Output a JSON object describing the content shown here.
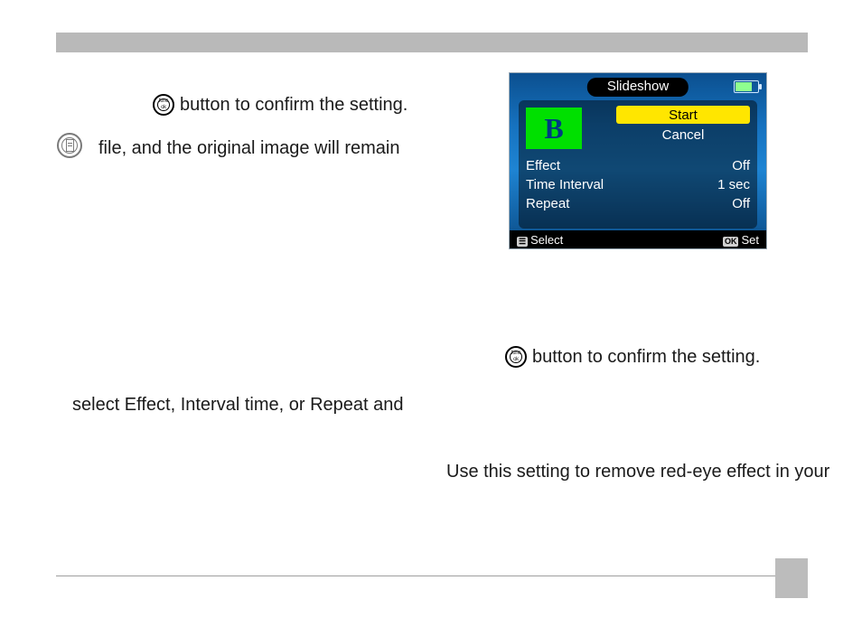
{
  "icon_labels": {
    "func_top": "func",
    "func_bottom": "ok"
  },
  "body": {
    "line1": "button to confirm the setting.",
    "line2": "file, and the original image will remain",
    "line3": "select Effect, Interval time, or Repeat and",
    "line4": "button to confirm the setting.",
    "line5": "Use this setting to remove red-eye effect in your"
  },
  "lcd": {
    "title": "Slideshow",
    "preview_letter": "B",
    "start": "Start",
    "cancel": "Cancel",
    "rows": [
      {
        "label": "Effect",
        "value": "Off"
      },
      {
        "label": "Time Interval",
        "value": "1 sec"
      },
      {
        "label": "Repeat",
        "value": "Off"
      }
    ],
    "footer_left_key": "☰",
    "footer_left": "Select",
    "footer_right_key": "OK",
    "footer_right": "Set"
  }
}
